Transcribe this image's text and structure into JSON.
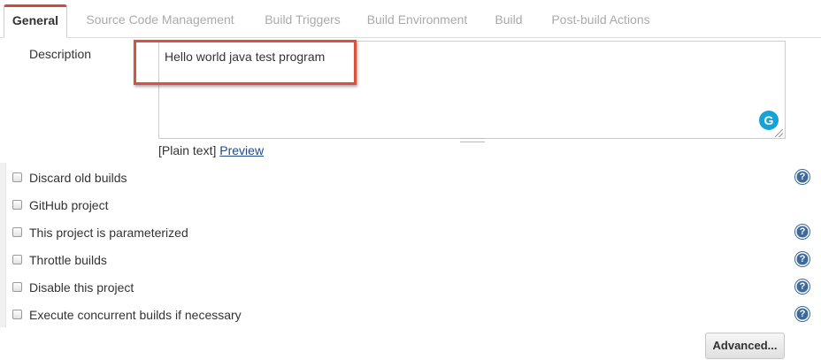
{
  "tabs": [
    {
      "label": "General",
      "active": true
    },
    {
      "label": "Source Code Management",
      "active": false
    },
    {
      "label": "Build Triggers",
      "active": false
    },
    {
      "label": "Build Environment",
      "active": false
    },
    {
      "label": "Build",
      "active": false
    },
    {
      "label": "Post-build Actions",
      "active": false
    }
  ],
  "description": {
    "label": "Description",
    "value": "Hello world java test program",
    "text_mode": "[Plain text]",
    "preview_link": "Preview",
    "grammarly_glyph": "G"
  },
  "options": [
    {
      "label": "Discard old builds",
      "checked": false,
      "help": true
    },
    {
      "label": "GitHub project",
      "checked": false,
      "help": false
    },
    {
      "label": "This project is parameterized",
      "checked": false,
      "help": true
    },
    {
      "label": "Throttle builds",
      "checked": false,
      "help": true
    },
    {
      "label": "Disable this project",
      "checked": false,
      "help": true
    },
    {
      "label": "Execute concurrent builds if necessary",
      "checked": false,
      "help": true
    }
  ],
  "help_glyph": "?",
  "advanced_button": "Advanced...",
  "colors": {
    "active_tab_accent": "#d24939",
    "highlight_box": "#d9533c",
    "help_icon": "#3c6a9c",
    "link": "#204a87",
    "grammarly": "#15a2d6"
  },
  "icons": {
    "help": "help-icon",
    "grammarly": "grammarly-icon"
  }
}
